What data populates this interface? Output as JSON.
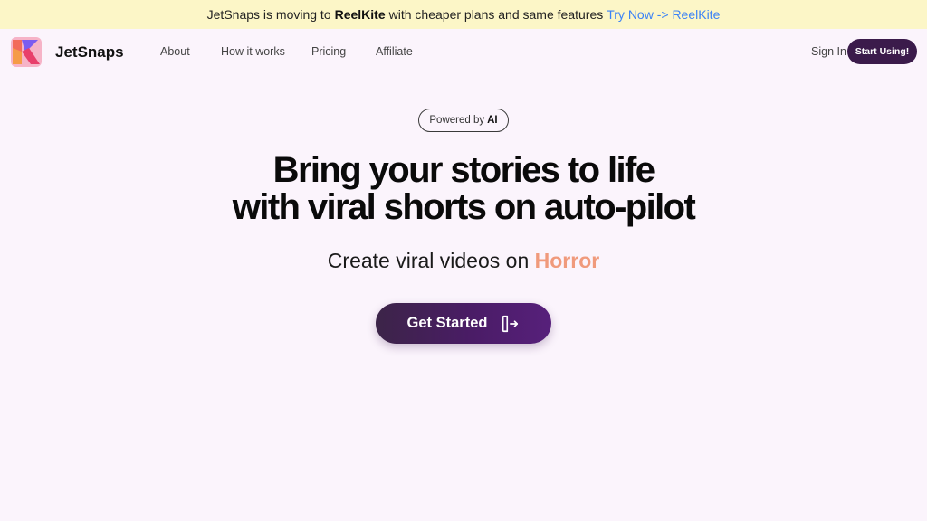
{
  "banner": {
    "prefix": "JetSnaps is moving to",
    "highlight": "ReelKite",
    "suffix": "with cheaper plans and same features",
    "link": "Try Now -> ReelKite",
    "background": "#fcf6c7",
    "link_color": "#3b82f6"
  },
  "nav": {
    "brand": "JetSnaps",
    "logo_icon": "k-logo-icon",
    "links": [
      "About",
      "How it works",
      "Pricing",
      "Affiliate"
    ],
    "sign_in": "Sign In",
    "start_button": "Start Using!"
  },
  "hero": {
    "pill_prefix": "Powered by",
    "pill_strong": "AI",
    "headline_line1": "Bring your stories to life",
    "headline_line2": "with viral shorts on auto-pilot",
    "sub_prefix": "Create viral videos on",
    "sub_accent": "Horror",
    "cta_label": "Get Started",
    "cta_icon": "log-in-arrow-icon"
  },
  "colors": {
    "page_background": "#fbf4fc",
    "accent": "#f09a7c",
    "primary_button": "#3b1b4b"
  }
}
